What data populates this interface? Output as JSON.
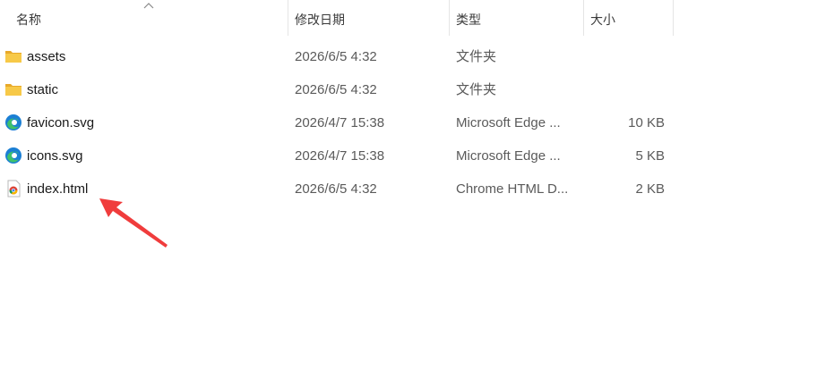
{
  "columns": {
    "name": "名称",
    "date": "修改日期",
    "type": "类型",
    "size": "大小"
  },
  "files": [
    {
      "name": "assets",
      "date": "2026/6/5 4:32",
      "type": "文件夹",
      "size": "",
      "icon": "folder-icon"
    },
    {
      "name": "static",
      "date": "2026/6/5 4:32",
      "type": "文件夹",
      "size": "",
      "icon": "folder-icon"
    },
    {
      "name": "favicon.svg",
      "date": "2026/4/7 15:38",
      "type": "Microsoft Edge ...",
      "size": "10 KB",
      "icon": "edge-icon"
    },
    {
      "name": "icons.svg",
      "date": "2026/4/7 15:38",
      "type": "Microsoft Edge ...",
      "size": "5 KB",
      "icon": "edge-icon"
    },
    {
      "name": "index.html",
      "date": "2026/6/5 4:32",
      "type": "Chrome HTML D...",
      "size": "2 KB",
      "icon": "chrome-html-icon"
    }
  ],
  "colors": {
    "folder": "#f7c948",
    "edge_blue": "#1b7fd4",
    "edge_green": "#3fc16b",
    "annotation_arrow": "#f03c3c"
  }
}
